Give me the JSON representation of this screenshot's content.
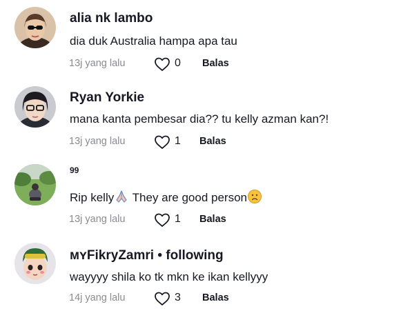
{
  "comments": [
    {
      "username": "alia nk lambo",
      "text": "dia duk Australia hampa apa tau",
      "time": "13j yang lalu",
      "likes": "0",
      "reply_label": "Balas"
    },
    {
      "username": "Ryan Yorkie",
      "text": "mana kanta pembesar dia?? tu kelly azman kan?!",
      "time": "13j yang lalu",
      "likes": "1",
      "reply_label": "Balas"
    },
    {
      "username": "99",
      "text_before": "Rip kelly",
      "text_middle": " They are good person",
      "emojis": [
        "folded-hands-emoji",
        "sad-face-emoji"
      ],
      "time": "13j yang lalu",
      "likes": "1",
      "reply_label": "Balas"
    },
    {
      "username": "ᴍʏFikryZamri",
      "following_label": " • following",
      "text": "wayyyy shila ko tk mkn ke ikan kellyyy",
      "time": "14j yang lalu",
      "likes": "3",
      "reply_label": "Balas"
    }
  ],
  "colors": {
    "text": "#161823",
    "muted": "#8a8b91",
    "heart_outline": "#161823"
  },
  "icons": [
    "heart-outline-icon"
  ]
}
